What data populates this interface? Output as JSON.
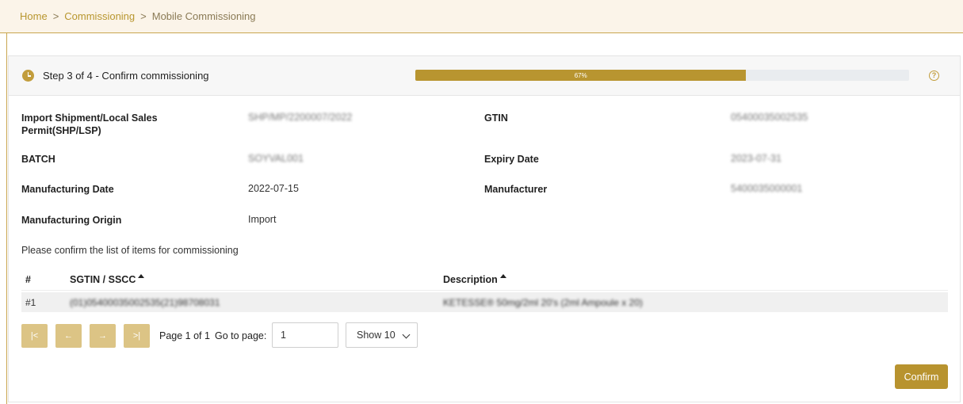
{
  "breadcrumb": {
    "items": [
      "Home",
      "Commissioning",
      "Mobile Commissioning"
    ],
    "separator": ">"
  },
  "step": {
    "title": "Step 3 of 4 - Confirm commissioning",
    "progress_percent": 67,
    "progress_label": "67%"
  },
  "details": {
    "permit_label": "Import Shipment/Local Sales Permit(SHP/LSP)",
    "permit_value": "SHP/MP/2200007/2022",
    "gtin_label": "GTIN",
    "gtin_value": "05400035002535",
    "batch_label": "BATCH",
    "batch_value": "SOYVAL001",
    "expiry_label": "Expiry Date",
    "expiry_value": "2023-07-31",
    "mfg_date_label": "Manufacturing Date",
    "mfg_date_value": "2022-07-15",
    "manufacturer_label": "Manufacturer",
    "manufacturer_value": "5400035000001",
    "origin_label": "Manufacturing Origin",
    "origin_value": "Import"
  },
  "instruction": "Please confirm the list of items for commissioning",
  "table": {
    "headers": [
      "#",
      "SGTIN / SSCC",
      "Description"
    ],
    "rows": [
      {
        "index": "#1",
        "sgtin": "(01)05400035002535(21)98708031",
        "description": "KETESSE® 50mg/2ml 20's (2ml Ampoule x 20)"
      }
    ]
  },
  "pager": {
    "first": "|<",
    "prev": "←",
    "next": "→",
    "last": ">|",
    "page_info": "Page 1 of 1",
    "goto_label": "Go to page:",
    "goto_value": "1",
    "show_value": "Show 10"
  },
  "confirm_label": "Confirm",
  "colors": {
    "accent": "#b8932f",
    "pager_button": "#dcc485",
    "breadcrumb_bg": "#fbf4e9"
  },
  "icons": [
    "clock-icon",
    "help-icon",
    "sort-up-icon",
    "chevron-down-icon"
  ]
}
